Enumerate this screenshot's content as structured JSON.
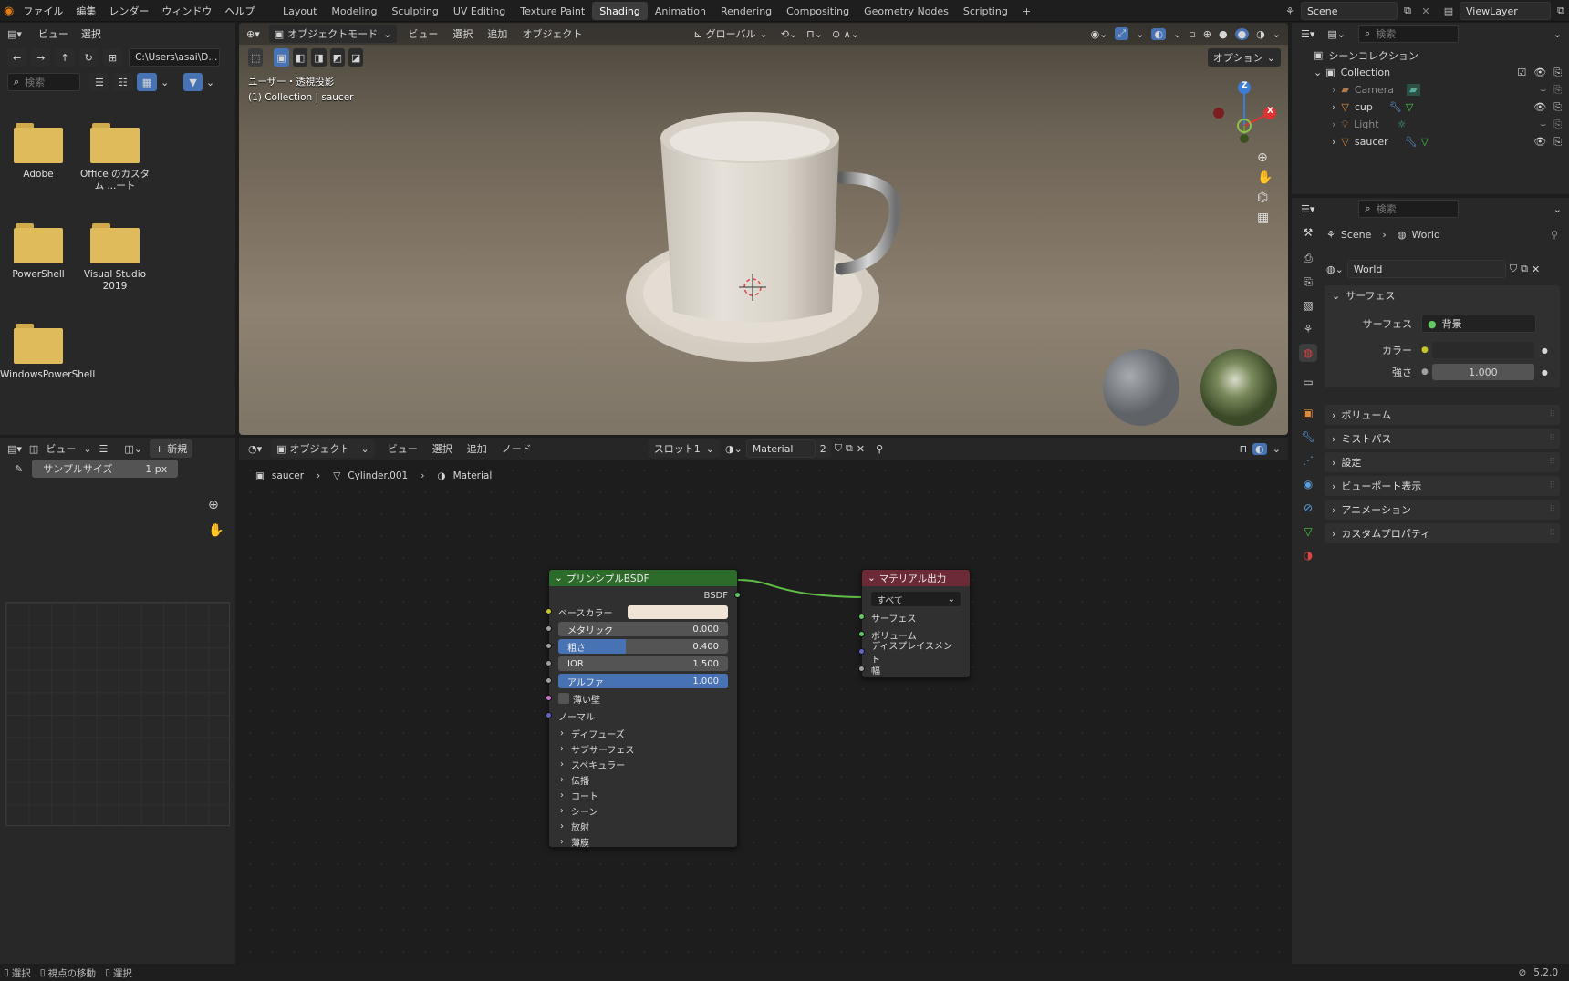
{
  "topbar": {
    "menus": [
      "ファイル",
      "編集",
      "レンダー",
      "ウィンドウ",
      "ヘルプ"
    ],
    "workspaces": [
      "Layout",
      "Modeling",
      "Sculpting",
      "UV Editing",
      "Texture Paint",
      "Shading",
      "Animation",
      "Rendering",
      "Compositing",
      "Geometry Nodes",
      "Scripting"
    ],
    "active_workspace": "Shading",
    "scene": "Scene",
    "view_layer": "ViewLayer"
  },
  "filebrowser": {
    "menus": [
      "ビュー",
      "選択"
    ],
    "path": "C:\\Users\\asai\\D...",
    "search_placeholder": "検索",
    "folders": [
      "Adobe",
      "Office のカスタム ...ート",
      "PowerShell",
      "Visual Studio 2019",
      "WindowsPowerShell"
    ]
  },
  "viewport": {
    "mode": "オブジェクトモード",
    "menus": [
      "ビュー",
      "選択",
      "追加",
      "オブジェクト"
    ],
    "transform": "グローバル",
    "options": "オプション",
    "overlay_line1": "ユーザー・透視投影",
    "overlay_line2": "(1) Collection | saucer",
    "axes": {
      "z": "Z",
      "x": "X"
    }
  },
  "image_editor": {
    "menus": [
      "ビュー"
    ],
    "new_label": "新規",
    "sample_label": "サンプルサイズ",
    "sample_value": "1 px"
  },
  "node_editor": {
    "type": "オブジェクト",
    "menus": [
      "ビュー",
      "選択",
      "追加",
      "ノード"
    ],
    "slot": "スロット1",
    "material": "Material",
    "users": "2",
    "breadcrumb": [
      "saucer",
      "Cylinder.001",
      "Material"
    ],
    "bsdf": {
      "title": "プリンシプルBSDF",
      "output": "BSDF",
      "base_color": "ベースカラー",
      "metallic": {
        "label": "メタリック",
        "value": "0.000",
        "fraction": 0.0
      },
      "roughness": {
        "label": "粗さ",
        "value": "0.400",
        "fraction": 0.4
      },
      "ior": {
        "label": "IOR",
        "value": "1.500",
        "fraction": 0.0
      },
      "alpha": {
        "label": "アルファ",
        "value": "1.000",
        "fraction": 1.0
      },
      "thin_wall": "薄い壁",
      "normal": "ノーマル",
      "subpanels": [
        "ディフューズ",
        "サブサーフェス",
        "スペキュラー",
        "伝播",
        "コート",
        "シーン",
        "放射",
        "薄膜"
      ]
    },
    "output_node": {
      "title": "マテリアル出力",
      "target": "すべて",
      "inputs": [
        "サーフェス",
        "ボリューム",
        "ディスプレイスメント",
        "幅"
      ]
    }
  },
  "outliner": {
    "search_placeholder": "検索",
    "root": "シーンコレクション",
    "collection": "Collection",
    "objects": [
      "Camera",
      "cup",
      "Light",
      "saucer"
    ]
  },
  "properties": {
    "search_placeholder": "検索",
    "breadcrumb": [
      "Scene",
      "World"
    ],
    "world_name": "World",
    "surface_section": "サーフェス",
    "surface_label": "サーフェス",
    "surface_value": "背景",
    "color_label": "カラー",
    "strength_label": "強さ",
    "strength_value": "1.000",
    "sections": [
      "ボリューム",
      "ミストパス",
      "設定",
      "ビューポート表示",
      "アニメーション",
      "カスタムプロパティ"
    ]
  },
  "statusbar": {
    "items": [
      "選択",
      "視点の移動",
      "選択"
    ],
    "version": "5.2.0"
  }
}
